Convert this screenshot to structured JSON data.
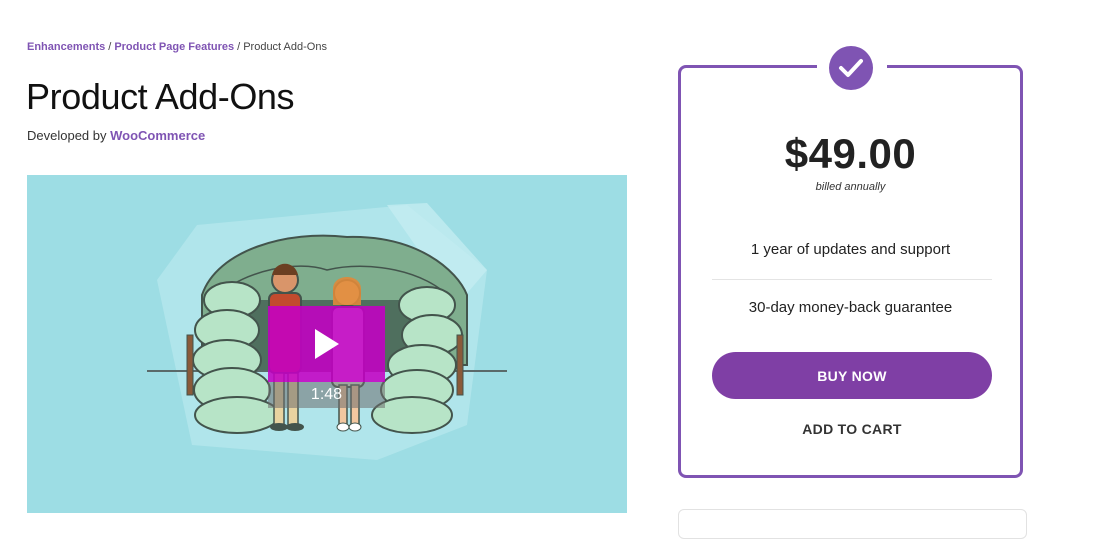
{
  "breadcrumb": {
    "items": [
      "Enhancements",
      "Product Page Features"
    ],
    "separator": "/",
    "current": "Product Add-Ons"
  },
  "product": {
    "title": "Product Add-Ons",
    "developed_by_label": "Developed by",
    "developer": "WooCommerce"
  },
  "video": {
    "duration": "1:48",
    "play_icon": "play-icon",
    "background_color": "#9ddde4",
    "play_color": "#c400c4"
  },
  "pricing": {
    "price": "$49.00",
    "billing": "billed annually",
    "features": [
      "1 year of updates and support",
      "30-day money-back guarantee"
    ],
    "buy_now_label": "BUY NOW",
    "add_to_cart_label": "ADD TO CART",
    "badge_icon": "checkmark-icon",
    "accent_color": "#7f54b3"
  }
}
